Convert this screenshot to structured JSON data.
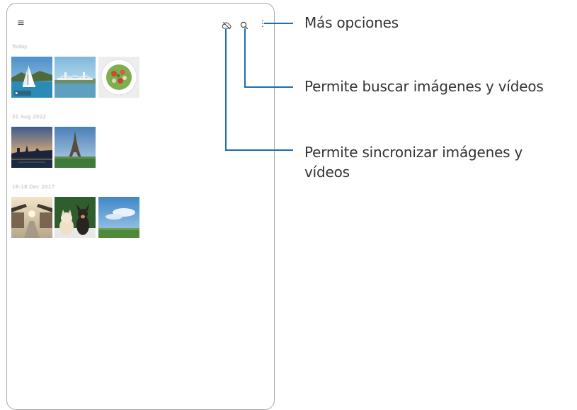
{
  "toolbar": {
    "icons": [
      "menu-icon",
      "cloud-sync-icon",
      "search-icon",
      "more-options-icon"
    ],
    "menu_glyph": "≡",
    "more_glyph": "⋮"
  },
  "sections": [
    {
      "date_label": "Today"
    },
    {
      "date_label": "31 Aug 2022"
    },
    {
      "date_label": "16-18 Dec 2017"
    }
  ],
  "callouts": {
    "more_options": "Más opciones",
    "search": "Permite buscar imágenes y vídeos",
    "sync_line1": "Permite sincronizar imágenes y",
    "sync_line2": "vídeos"
  },
  "colors": {
    "callout_line": "#1b6fb0",
    "frame": "#a8a8a8"
  }
}
